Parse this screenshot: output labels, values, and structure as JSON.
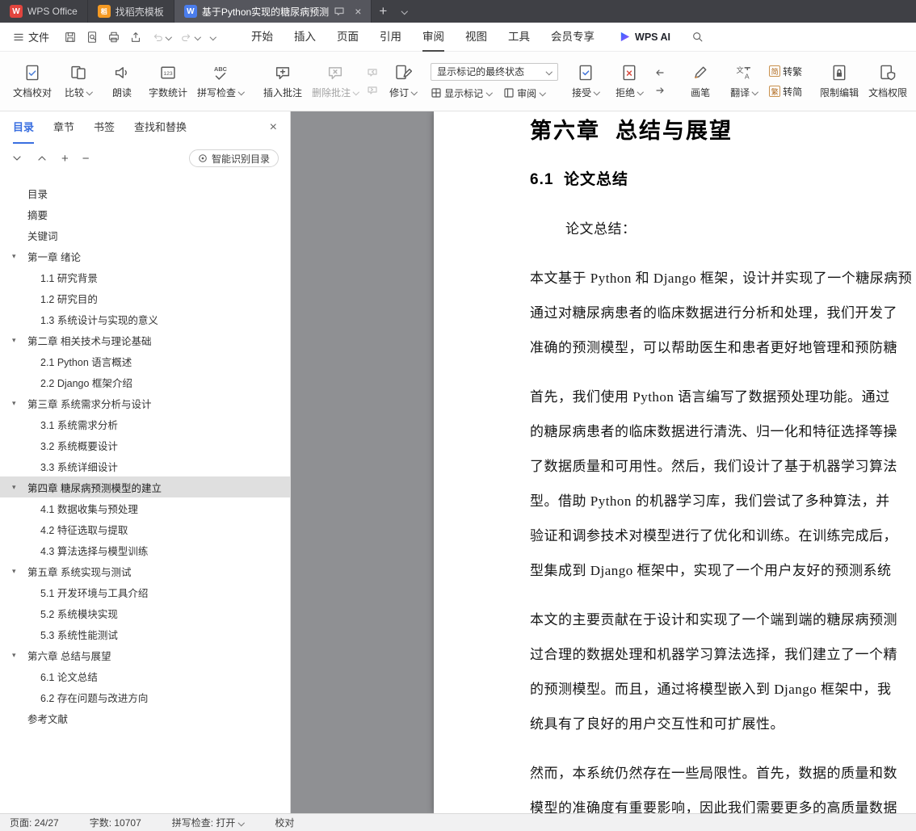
{
  "tabbar": {
    "tabs": [
      {
        "label": "WPS Office"
      },
      {
        "label": "找稻壳模板"
      },
      {
        "label": "基于Python实现的糖尿病预测"
      }
    ]
  },
  "menubar": {
    "file": "文件",
    "items": [
      "开始",
      "插入",
      "页面",
      "引用",
      "审阅",
      "视图",
      "工具",
      "会员专享"
    ],
    "ai": "WPS AI"
  },
  "ribbon": {
    "doc_proof": "文档校对",
    "compare": "比较",
    "read_aloud": "朗读",
    "word_count": "字数统计",
    "spell_check": "拼写检查",
    "insert_comment": "插入批注",
    "delete_comment": "删除批注",
    "track_changes": "修订",
    "markup_state": "显示标记的最终状态",
    "show_markup": "显示标记",
    "review_pane": "审阅",
    "accept": "接受",
    "reject": "拒绝",
    "pen": "画笔",
    "translate": "翻译",
    "to_trad": "转繁",
    "to_simp": "转简",
    "restrict_edit": "限制编辑",
    "doc_permission": "文档权限"
  },
  "sidebar": {
    "tabs": [
      "目录",
      "章节",
      "书签",
      "查找和替换"
    ],
    "smart_toc": "智能识别目录",
    "toc": [
      {
        "label": "目录"
      },
      {
        "label": "摘要"
      },
      {
        "label": "关键词"
      },
      {
        "label": "第一章 绪论"
      },
      {
        "label": "1.1 研究背景"
      },
      {
        "label": "1.2 研究目的"
      },
      {
        "label": "1.3 系统设计与实现的意义"
      },
      {
        "label": "第二章 相关技术与理论基础"
      },
      {
        "label": "2.1 Python 语言概述"
      },
      {
        "label": "2.2 Django 框架介绍"
      },
      {
        "label": "第三章 系统需求分析与设计"
      },
      {
        "label": "3.1 系统需求分析"
      },
      {
        "label": "3.2 系统概要设计"
      },
      {
        "label": "3.3 系统详细设计"
      },
      {
        "label": "第四章 糖尿病预测模型的建立"
      },
      {
        "label": "4.1 数据收集与预处理"
      },
      {
        "label": "4.2 特征选取与提取"
      },
      {
        "label": "4.3 算法选择与模型训练"
      },
      {
        "label": "第五章 系统实现与测试"
      },
      {
        "label": "5.1 开发环境与工具介绍"
      },
      {
        "label": "5.2 系统模块实现"
      },
      {
        "label": "5.3 系统性能测试"
      },
      {
        "label": "第六章 总结与展望"
      },
      {
        "label": "6.1 论文总结"
      },
      {
        "label": "6.2 存在问题与改进方向"
      },
      {
        "label": "参考文献"
      }
    ]
  },
  "document": {
    "chapter_title": "第六章  总结与展望",
    "section_title": "6.1  论文总结",
    "p0": "论文总结：",
    "p1": [
      "本文基于 Python 和 Django 框架，设计并实现了一个糖尿病预",
      "通过对糖尿病患者的临床数据进行分析和处理，我们开发了",
      "准确的预测模型，可以帮助医生和患者更好地管理和预防糖"
    ],
    "p2": [
      "首先，我们使用 Python 语言编写了数据预处理功能。通过",
      "的糖尿病患者的临床数据进行清洗、归一化和特征选择等操",
      "了数据质量和可用性。然后，我们设计了基于机器学习算法",
      "型。借助 Python 的机器学习库，我们尝试了多种算法，并",
      "验证和调参技术对模型进行了优化和训练。在训练完成后，",
      "型集成到 Django 框架中，实现了一个用户友好的预测系统"
    ],
    "p3": [
      "本文的主要贡献在于设计和实现了一个端到端的糖尿病预测",
      "过合理的数据处理和机器学习算法选择，我们建立了一个精",
      "的预测模型。而且，通过将模型嵌入到 Django 框架中，我",
      "统具有了良好的用户交互性和可扩展性。"
    ],
    "p4": [
      "然而，本系统仍然存在一些局限性。首先，数据的质量和数",
      "模型的准确度有重要影响，因此我们需要更多的高质量数据"
    ]
  },
  "statusbar": {
    "page": "页面: 24/27",
    "words": "字数: 10707",
    "spell": "拼写检查: 打开",
    "proof": "校对"
  }
}
